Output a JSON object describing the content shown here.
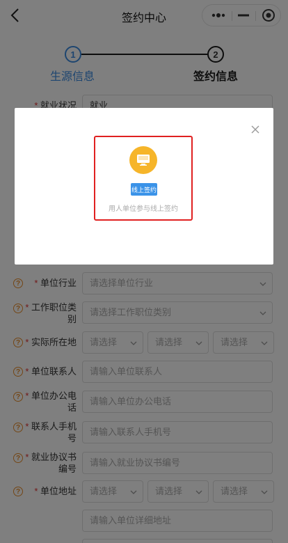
{
  "header": {
    "title": "签约中心",
    "back_icon": "chevron-left-icon",
    "more_icon": "more-dots-icon",
    "minimize_icon": "minus-icon",
    "close_icon": "target-circle-icon"
  },
  "steps": [
    {
      "number": "1",
      "label": "生源信息",
      "color": "#3b8be0"
    },
    {
      "number": "2",
      "label": "签约信息",
      "color": "#1a1a1a"
    }
  ],
  "form": {
    "employment_status": {
      "label": "就业状况",
      "value": "就业"
    },
    "industry": {
      "label": "单位行业",
      "placeholder": "请选择单位行业"
    },
    "position": {
      "label_line1": "工作职位类",
      "label_line2": "别",
      "placeholder": "请选择工作职位类别"
    },
    "location": {
      "label": "实际所在地",
      "placeholders": [
        "请选择",
        "请选择",
        "请选择"
      ]
    },
    "contact": {
      "label": "单位联系人",
      "placeholder": "请输入单位联系人"
    },
    "office_phone": {
      "label_line1": "单位办公电",
      "label_line2": "话",
      "placeholder": "请输入单位办公电话"
    },
    "mobile": {
      "label_line1": "联系人手机",
      "label_line2": "号",
      "placeholder": "请输入联系人手机号"
    },
    "agreement_no": {
      "label_line1": "就业协议书",
      "label_line2": "编号",
      "placeholder": "请输入就业协议书编号"
    },
    "address": {
      "label": "单位地址",
      "placeholders": [
        "请选择",
        "请选择",
        "请选择"
      ],
      "detail_placeholder": "请输入单位详细地址"
    }
  },
  "modal": {
    "option_icon": "monitor-icon",
    "badge": "线上签约",
    "caption": "用人单位参与线上签约",
    "close_icon": "close-icon"
  },
  "colors": {
    "accent": "#3b8be0",
    "required": "#e03030",
    "help": "#e88c2a",
    "highlight": "#e02020",
    "icon_bg": "#f6b52a"
  }
}
